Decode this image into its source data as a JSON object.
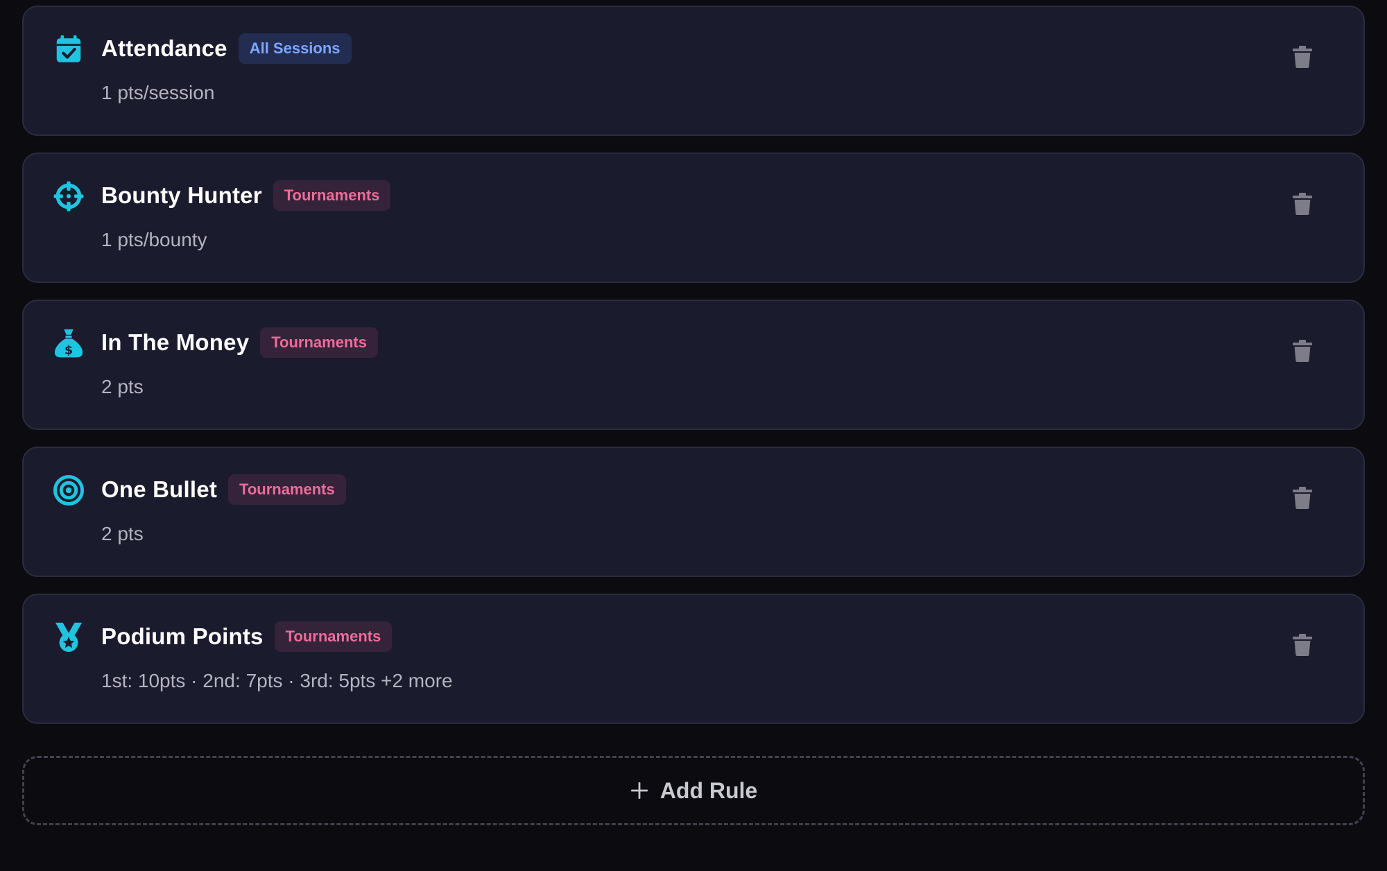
{
  "colors": {
    "accent_icon": "#22c3e0",
    "badge_blue_text": "#7ea7ff",
    "badge_pink_text": "#ee6c99",
    "card_background": "#1b1b2e",
    "page_background": "#0b0b10"
  },
  "rules": [
    {
      "title": "Attendance",
      "badge": "All Sessions",
      "badge_style": "blue",
      "description": "1 pts/session",
      "icon": "calendar-check-icon"
    },
    {
      "title": "Bounty Hunter",
      "badge": "Tournaments",
      "badge_style": "pink",
      "description": "1 pts/bounty",
      "icon": "crosshair-icon"
    },
    {
      "title": "In The Money",
      "badge": "Tournaments",
      "badge_style": "pink",
      "description": "2 pts",
      "icon": "money-bag-icon"
    },
    {
      "title": "One Bullet",
      "badge": "Tournaments",
      "badge_style": "pink",
      "description": "2 pts",
      "icon": "bullseye-icon"
    },
    {
      "title": "Podium Points",
      "badge": "Tournaments",
      "badge_style": "pink",
      "description": "1st: 10pts · 2nd: 7pts · 3rd: 5pts +2 more",
      "icon": "medal-icon"
    }
  ],
  "add_rule": {
    "label": "Add Rule",
    "icon": "plus-icon"
  },
  "delete_icon": "trash-icon"
}
